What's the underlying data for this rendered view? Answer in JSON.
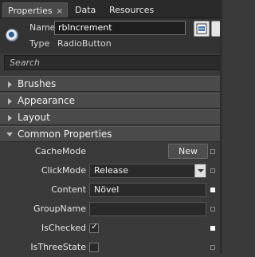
{
  "tabs": [
    {
      "label": "Properties",
      "close": "×"
    },
    {
      "label": "Data"
    },
    {
      "label": "Resources"
    }
  ],
  "header": {
    "name_label": "Name",
    "name_value": "rbIncrement",
    "type_label": "Type",
    "type_value": "RadioButton"
  },
  "search": {
    "placeholder": "Search"
  },
  "categories": [
    {
      "label": "Brushes"
    },
    {
      "label": "Appearance"
    },
    {
      "label": "Layout"
    },
    {
      "label": "Common Properties"
    }
  ],
  "properties": [
    {
      "label": "CacheMode",
      "button": "New"
    },
    {
      "label": "ClickMode",
      "value": "Release"
    },
    {
      "label": "Content",
      "value": "Növel"
    },
    {
      "label": "GroupName",
      "value": ""
    },
    {
      "label": "IsChecked",
      "check": "✓"
    },
    {
      "label": "IsThreeState"
    }
  ]
}
